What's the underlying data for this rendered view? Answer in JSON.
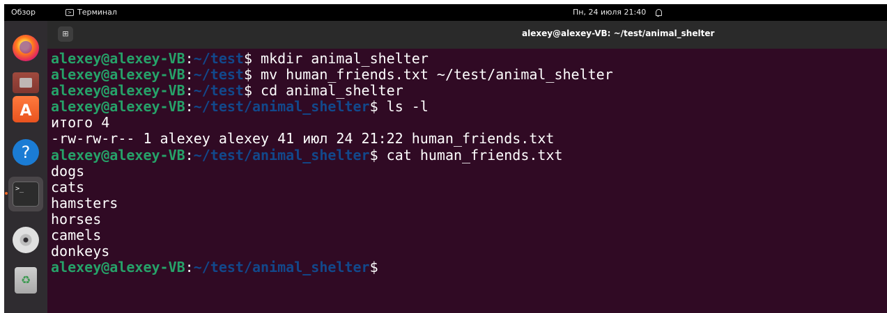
{
  "topbar": {
    "overview": "Обзор",
    "app_name": "Терминал",
    "datetime": "Пн, 24 июля 21:40",
    "status_icon": "notification-bell-icon"
  },
  "dock": {
    "items": [
      {
        "name": "Firefox",
        "icon": "firefox-icon"
      },
      {
        "name": "Files",
        "icon": "files-icon"
      },
      {
        "name": "App Center",
        "icon": "appcenter-icon",
        "glyph": "A"
      },
      {
        "name": "Help",
        "icon": "help-icon",
        "glyph": "?"
      },
      {
        "name": "Terminal",
        "icon": "terminal-icon",
        "glyph": ">_",
        "running": true
      },
      {
        "name": "Disc",
        "icon": "disc-icon"
      },
      {
        "name": "Trash",
        "icon": "trash-icon"
      }
    ]
  },
  "window": {
    "title": "alexey@alexey-VB: ~/test/animal_shelter",
    "new_tab_glyph": "⊞"
  },
  "terminal": {
    "colors": {
      "background": "#300a24",
      "user": "#26a269",
      "path": "#12488b",
      "text": "#ffffff"
    },
    "lines": [
      {
        "type": "prompt",
        "user": "alexey@alexey-VB",
        "colon": ":",
        "path": "~/test",
        "dollar": "$",
        "command": " mkdir animal_shelter"
      },
      {
        "type": "prompt",
        "user": "alexey@alexey-VB",
        "colon": ":",
        "path": "~/test",
        "dollar": "$",
        "command": " mv human_friends.txt ~/test/animal_shelter"
      },
      {
        "type": "prompt",
        "user": "alexey@alexey-VB",
        "colon": ":",
        "path": "~/test",
        "dollar": "$",
        "command": " cd animal_shelter"
      },
      {
        "type": "prompt",
        "user": "alexey@alexey-VB",
        "colon": ":",
        "path": "~/test/animal_shelter",
        "dollar": "$",
        "command": " ls -l"
      },
      {
        "type": "output",
        "text": "итого 4"
      },
      {
        "type": "output",
        "text": "-rw-rw-r-- 1 alexey alexey 41 июл 24 21:22 human_friends.txt"
      },
      {
        "type": "prompt",
        "user": "alexey@alexey-VB",
        "colon": ":",
        "path": "~/test/animal_shelter",
        "dollar": "$",
        "command": " cat human_friends.txt"
      },
      {
        "type": "output",
        "text": "dogs"
      },
      {
        "type": "output",
        "text": "cats"
      },
      {
        "type": "output",
        "text": "hamsters"
      },
      {
        "type": "output",
        "text": "horses"
      },
      {
        "type": "output",
        "text": "camels"
      },
      {
        "type": "output",
        "text": "donkeys"
      },
      {
        "type": "prompt",
        "user": "alexey@alexey-VB",
        "colon": ":",
        "path": "~/test/animal_shelter",
        "dollar": "$",
        "command": ""
      }
    ]
  }
}
